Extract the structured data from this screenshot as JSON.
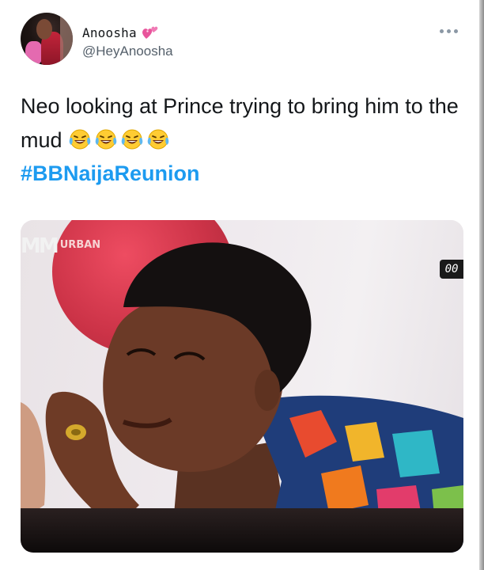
{
  "tweet": {
    "author": {
      "display_name": "Anoosha",
      "handle": "@HeyAnoosha",
      "name_emoji": "two-hearts-icon"
    },
    "more_menu_icon": "more-icon",
    "text": "Neo looking at Prince trying to bring him to the mud",
    "text_emojis": [
      "laughing-tears-icon",
      "laughing-tears-icon",
      "laughing-tears-icon",
      "laughing-tears-icon"
    ],
    "hashtag": "#BBNaijaReunion",
    "media": {
      "channel_logo": {
        "mark": "M",
        "label": "URBAN"
      },
      "timer": "00"
    }
  },
  "colors": {
    "hashtag": "#1d9bf0",
    "text": "#14171a",
    "handle": "#55606b",
    "heart": "#e8559c"
  }
}
